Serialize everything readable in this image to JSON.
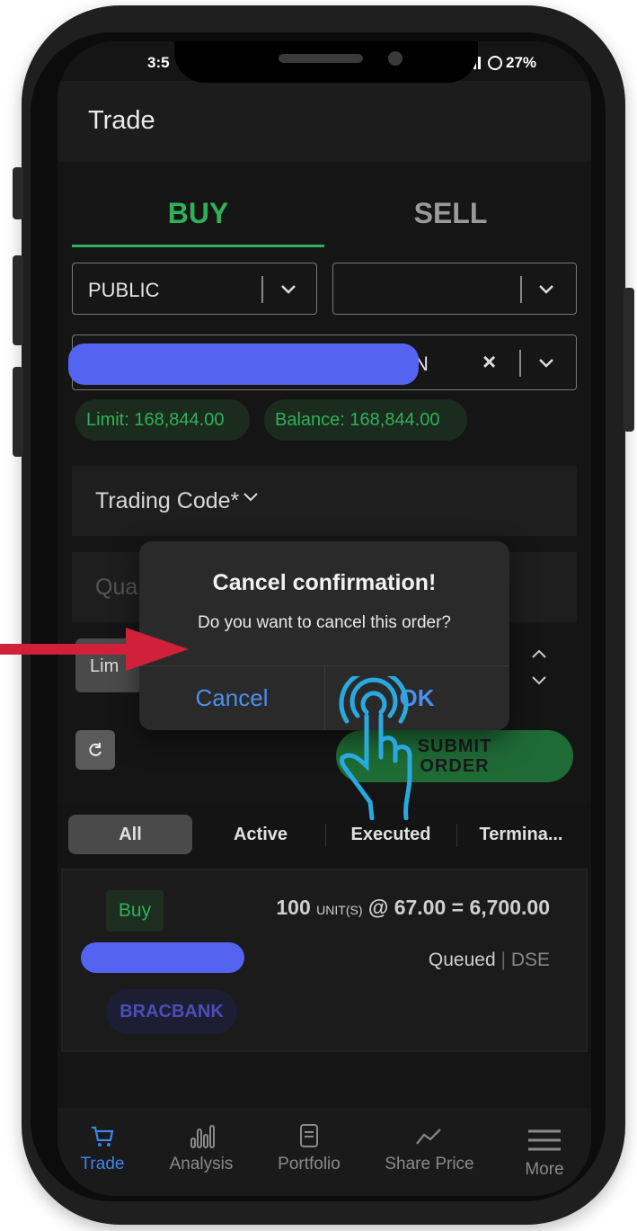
{
  "status_bar": {
    "time": "3:5",
    "battery": "27%"
  },
  "header": {
    "title": "Trade"
  },
  "tabs": [
    {
      "label": "BUY",
      "active": true
    },
    {
      "label": "SELL",
      "active": false
    }
  ],
  "form": {
    "market_select": {
      "value": "PUBLIC"
    },
    "second_select": {
      "value": ""
    },
    "account_select": {
      "value_suffix": "N",
      "clear_icon": "×"
    },
    "limit_pill": "Limit: 168,844.00",
    "balance_pill": "Balance: 168,844.00",
    "trading_code": {
      "label": "Trading Code*"
    },
    "quantity": {
      "placeholder": "Qua"
    },
    "order_type": {
      "value": "Lim"
    },
    "submit_label_line1": "SUBMIT",
    "submit_label_line2": "ORDER"
  },
  "dialog": {
    "title": "Cancel confirmation!",
    "message": "Do you want to cancel this order?",
    "cancel_label": "Cancel",
    "ok_label": "OK"
  },
  "order_filters": [
    "All",
    "Active",
    "Executed",
    "Termina..."
  ],
  "order": {
    "side": "Buy",
    "quantity": "100",
    "unit_label": "UNIT(S)",
    "price_expr": "@ 67.00 = 6,700.00",
    "status": "Queued",
    "exchange": "DSE",
    "ticker": "BRACBANK"
  },
  "bottom_nav": [
    {
      "label": "Trade",
      "icon": "cart-icon",
      "active": true
    },
    {
      "label": "Analysis",
      "icon": "bar-chart-icon",
      "active": false
    },
    {
      "label": "Portfolio",
      "icon": "document-icon",
      "active": false
    },
    {
      "label": "Share Price",
      "icon": "trend-line-icon",
      "active": false
    },
    {
      "label": "More",
      "icon": "menu-icon",
      "active": false
    }
  ],
  "colors": {
    "buy_green": "#2fb15a",
    "accent_blue": "#3d86e6",
    "redaction": "#5563f1",
    "annotation_red": "#d0203a",
    "annotation_cyan": "#2aa9e0"
  }
}
